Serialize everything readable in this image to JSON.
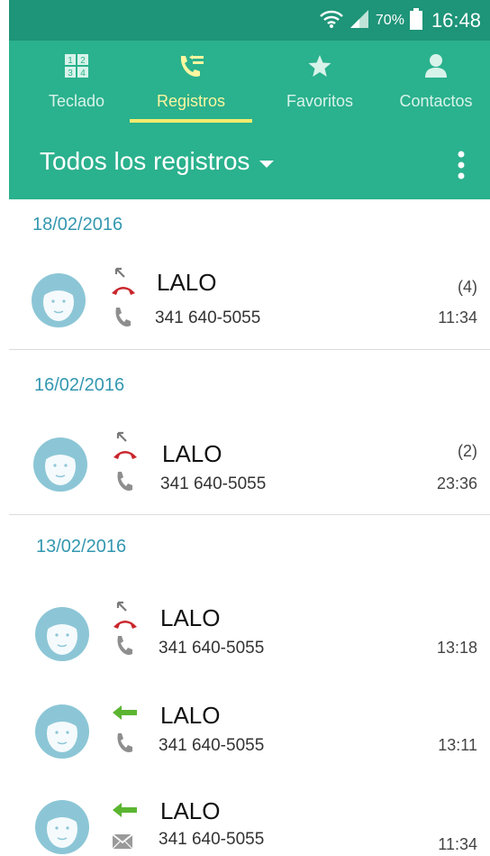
{
  "status_bar": {
    "battery_text": "70%",
    "clock": "16:48"
  },
  "tabs": [
    {
      "label": "Teclado",
      "icon": "dialpad-icon",
      "active": false
    },
    {
      "label": "Registros",
      "icon": "call-log-icon",
      "active": true
    },
    {
      "label": "Favoritos",
      "icon": "star-icon",
      "active": false
    },
    {
      "label": "Contactos",
      "icon": "person-icon",
      "active": false
    }
  ],
  "filter": {
    "label": "Todos los registros"
  },
  "groups": [
    {
      "date": "18/02/2016",
      "entries": [
        {
          "name": "LALO",
          "number": "341 640-5055",
          "count": "(4)",
          "time": "11:34",
          "type": "missed",
          "channel": "call"
        }
      ]
    },
    {
      "date": "16/02/2016",
      "entries": [
        {
          "name": "LALO",
          "number": "341 640-5055",
          "count": "(2)",
          "time": "23:36",
          "type": "missed",
          "channel": "call"
        }
      ]
    },
    {
      "date": "13/02/2016",
      "entries": [
        {
          "name": "LALO",
          "number": "341 640-5055",
          "time": "13:18",
          "type": "missed",
          "channel": "call"
        },
        {
          "name": "LALO",
          "number": "341 640-5055",
          "time": "13:11",
          "type": "incoming",
          "channel": "call"
        },
        {
          "name": "LALO",
          "number": "341 640-5055",
          "time": "11:34",
          "type": "incoming",
          "channel": "message"
        }
      ]
    }
  ],
  "colors": {
    "status_bar": "#1e9478",
    "header": "#2ab18d",
    "active_tab": "#fbf6a0",
    "date_text": "#3497b0",
    "missed_icon": "#c9262c",
    "incoming_icon": "#5bb531",
    "avatar_bg": "#8cc6d6"
  }
}
